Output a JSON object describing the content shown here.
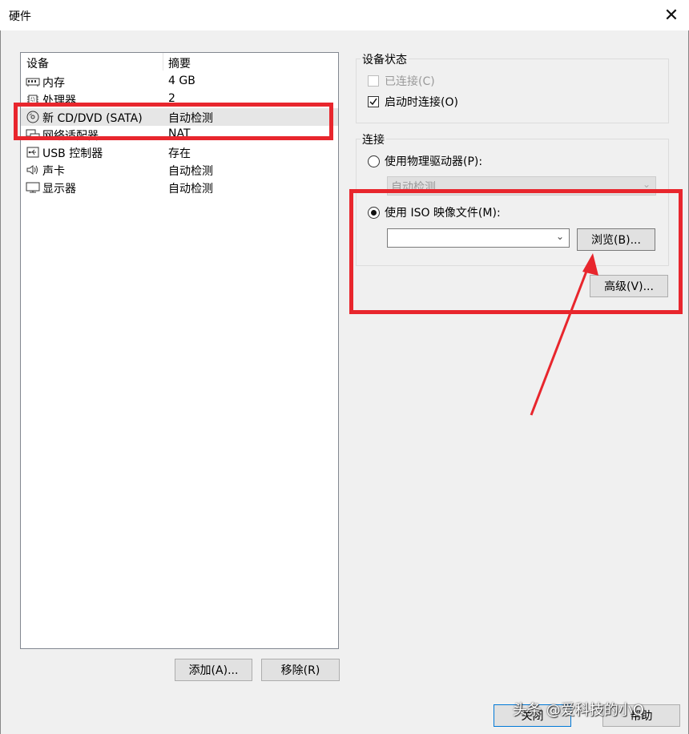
{
  "window": {
    "title": "硬件"
  },
  "device_list": {
    "header_device": "设备",
    "header_summary": "摘要",
    "rows": [
      {
        "name": "内存",
        "summary": "4 GB",
        "icon": "memory-icon"
      },
      {
        "name": "处理器",
        "summary": "2",
        "icon": "cpu-icon"
      },
      {
        "name": "新 CD/DVD (SATA)",
        "summary": "自动检测",
        "icon": "cd-dvd-icon",
        "selected": true
      },
      {
        "name": "网络适配器",
        "summary": "NAT",
        "icon": "network-icon"
      },
      {
        "name": "USB 控制器",
        "summary": "存在",
        "icon": "usb-icon"
      },
      {
        "name": "声卡",
        "summary": "自动检测",
        "icon": "sound-icon"
      },
      {
        "name": "显示器",
        "summary": "自动检测",
        "icon": "display-icon"
      }
    ]
  },
  "buttons": {
    "add": "添加(A)...",
    "remove": "移除(R)",
    "browse": "浏览(B)...",
    "advanced": "高级(V)...",
    "close": "关闭",
    "help": "帮助"
  },
  "device_status": {
    "title": "设备状态",
    "connected": "已连接(C)",
    "connect_on_start": "启动时连接(O)"
  },
  "connection": {
    "title": "连接",
    "physical_drive": "使用物理驱动器(P):",
    "physical_value": "自动检测",
    "iso_file": "使用 ISO 映像文件(M):",
    "iso_value": ""
  },
  "watermark": "头条 @爱科技的小Q",
  "colors": {
    "highlight": "#e8262d",
    "dialog_bg": "#f0f0f0",
    "button_bg": "#e1e1e1"
  }
}
